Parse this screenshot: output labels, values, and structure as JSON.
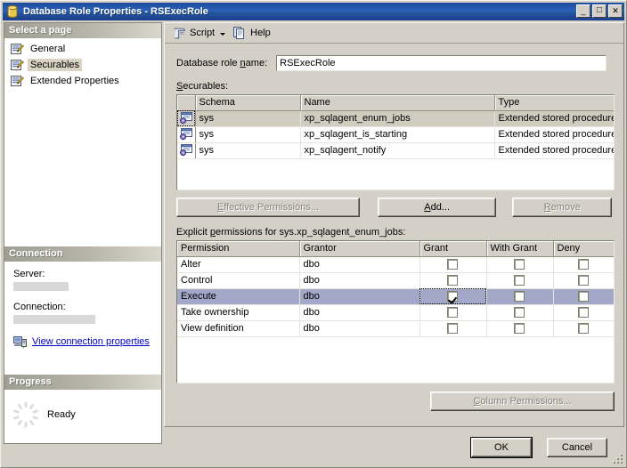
{
  "window": {
    "title": "Database Role Properties - RSExecRole",
    "title_icon": "database-role-icon",
    "buttons": {
      "minimize": "_",
      "maximize": "□",
      "close": "✕"
    }
  },
  "sidebar": {
    "select_a_page_header": "Select a page",
    "items": [
      {
        "label": "General",
        "icon": "page-icon",
        "selected": false
      },
      {
        "label": "Securables",
        "icon": "page-icon",
        "selected": true
      },
      {
        "label": "Extended Properties",
        "icon": "page-icon",
        "selected": false
      }
    ],
    "connection": {
      "header": "Connection",
      "server_label": "Server:",
      "server_value": "",
      "connection_label": "Connection:",
      "connection_value": "",
      "view_properties_link": "View connection properties",
      "link_icon": "server-connection-icon"
    },
    "progress": {
      "header": "Progress",
      "status": "Ready",
      "spinner_icon": "progress-spinner-icon"
    }
  },
  "toolbar": {
    "script_label": "Script",
    "script_icon": "script-icon",
    "script_caret": "chevron-down-icon",
    "help_label": "Help",
    "help_icon": "help-icon"
  },
  "main": {
    "role_name_label_pre": "Database role ",
    "role_name_label_mnemonic": "n",
    "role_name_label_post": "ame:",
    "role_name_value": "RSExecRole",
    "securables_label_mnemonic": "S",
    "securables_label_post": "ecurables:",
    "securables_grid": {
      "columns": [
        "",
        "Schema",
        "Name",
        "Type"
      ],
      "rows": [
        {
          "icon": "extended-stored-procedure-icon",
          "schema": "sys",
          "name": "xp_sqlagent_enum_jobs",
          "type": "Extended stored procedure",
          "selected": true
        },
        {
          "icon": "extended-stored-procedure-icon",
          "schema": "sys",
          "name": "xp_sqlagent_is_starting",
          "type": "Extended stored procedure",
          "selected": false
        },
        {
          "icon": "extended-stored-procedure-icon",
          "schema": "sys",
          "name": "xp_sqlagent_notify",
          "type": "Extended stored procedure",
          "selected": false
        }
      ]
    },
    "action_buttons": {
      "effective_permissions": {
        "label": "Effective Permissions...",
        "mnemonic": "E",
        "enabled": false
      },
      "add": {
        "label": "Add...",
        "mnemonic": "A",
        "enabled": true
      },
      "remove": {
        "label": "Remove",
        "mnemonic": "R",
        "enabled": false
      }
    },
    "explicit_label_pre": "Explicit ",
    "explicit_label_mnemonic": "p",
    "explicit_label_post": "ermissions for sys.xp_sqlagent_enum_jobs:",
    "permissions_grid": {
      "columns": [
        "Permission",
        "Grantor",
        "Grant",
        "With Grant",
        "Deny"
      ],
      "rows": [
        {
          "permission": "Alter",
          "grantor": "dbo",
          "grant": false,
          "with_grant": false,
          "deny": false,
          "selected": false
        },
        {
          "permission": "Control",
          "grantor": "dbo",
          "grant": false,
          "with_grant": false,
          "deny": false,
          "selected": false
        },
        {
          "permission": "Execute",
          "grantor": "dbo",
          "grant": true,
          "with_grant": false,
          "deny": false,
          "selected": true
        },
        {
          "permission": "Take ownership",
          "grantor": "dbo",
          "grant": false,
          "with_grant": false,
          "deny": false,
          "selected": false
        },
        {
          "permission": "View definition",
          "grantor": "dbo",
          "grant": false,
          "with_grant": false,
          "deny": false,
          "selected": false
        }
      ]
    },
    "column_permissions": {
      "label": "Column Permissions...",
      "mnemonic": "C",
      "enabled": false
    }
  },
  "footer": {
    "ok_label": "OK",
    "cancel_label": "Cancel",
    "resize_grip": "resize-grip-icon"
  },
  "colors": {
    "titlebar_accent": "#2b61b8",
    "dialog_face": "#d4d0c8",
    "section_header": "#b8b5aa",
    "link": "#0000c8",
    "selected_row": "#a4a8c8",
    "inactive_selected_row": "#d0ccc0",
    "redacted_value": "#d8d8d8"
  }
}
